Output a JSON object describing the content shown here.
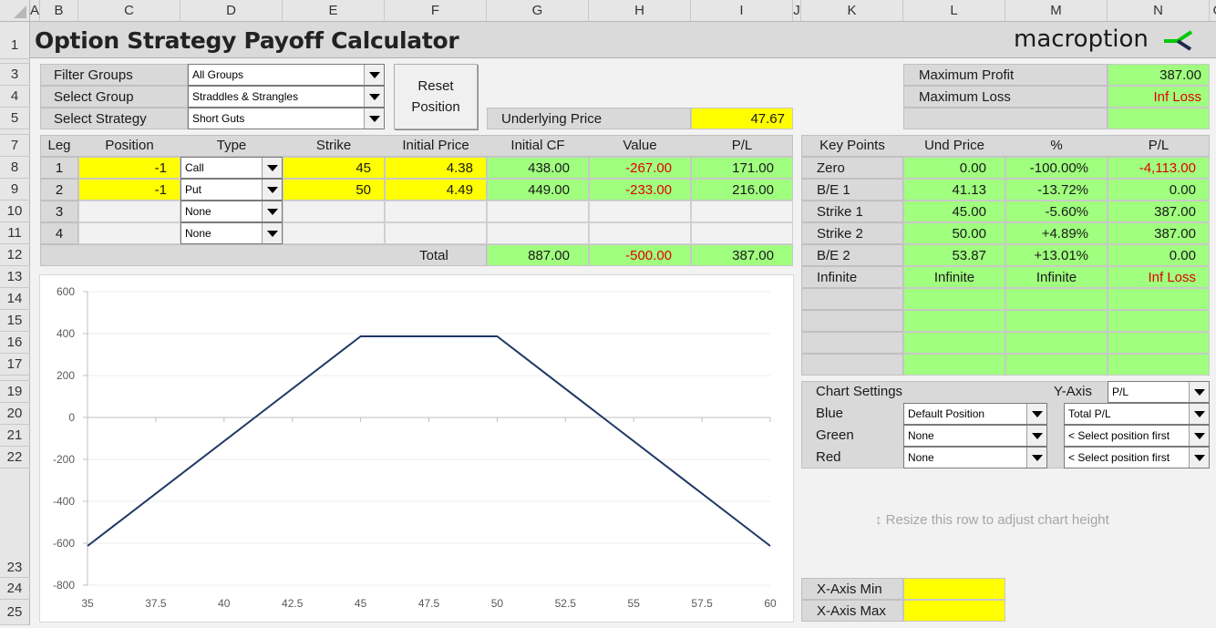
{
  "spreadsheet": {
    "columns": [
      "A",
      "B",
      "C",
      "D",
      "E",
      "F",
      "G",
      "H",
      "I",
      "J",
      "K",
      "L",
      "M",
      "N",
      "O"
    ],
    "rows": [
      "1",
      "3",
      "4",
      "5",
      "7",
      "8",
      "9",
      "10",
      "11",
      "12",
      "13",
      "14",
      "15",
      "16",
      "17",
      "19",
      "20",
      "21",
      "22",
      "23",
      "24",
      "25"
    ]
  },
  "header": {
    "title": "Option Strategy Payoff Calculator",
    "logo_text": "macroption",
    "logo_colors": {
      "green": "#00c800",
      "navy": "#1f2a4a"
    }
  },
  "selectors": {
    "filter_groups_label": "Filter Groups",
    "filter_groups_value": "All Groups",
    "select_group_label": "Select Group",
    "select_group_value": "Straddles & Strangles",
    "select_strategy_label": "Select Strategy",
    "select_strategy_value": "Short Guts"
  },
  "reset_button": {
    "line1": "Reset",
    "line2": "Position"
  },
  "underlying": {
    "label": "Underlying Price",
    "value": "47.67"
  },
  "summary": {
    "max_profit_label": "Maximum Profit",
    "max_profit_value": "387.00",
    "max_loss_label": "Maximum Loss",
    "max_loss_value": "Inf Loss"
  },
  "legs_table": {
    "headers": [
      "Leg",
      "Position",
      "Type",
      "Strike",
      "Initial Price",
      "Initial CF",
      "Value",
      "P/L"
    ],
    "rows": [
      {
        "leg": "1",
        "position": "-1",
        "type": "Call",
        "strike": "45",
        "initial_price": "4.38",
        "initial_cf": "438.00",
        "value": "-267.00",
        "pl": "171.00"
      },
      {
        "leg": "2",
        "position": "-1",
        "type": "Put",
        "strike": "50",
        "initial_price": "4.49",
        "initial_cf": "449.00",
        "value": "-233.00",
        "pl": "216.00"
      },
      {
        "leg": "3",
        "position": "",
        "type": "None",
        "strike": "",
        "initial_price": "",
        "initial_cf": "",
        "value": "",
        "pl": ""
      },
      {
        "leg": "4",
        "position": "",
        "type": "None",
        "strike": "",
        "initial_price": "",
        "initial_cf": "",
        "value": "",
        "pl": ""
      }
    ],
    "total": {
      "label": "Total",
      "initial_cf": "887.00",
      "value": "-500.00",
      "pl": "387.00"
    }
  },
  "key_points": {
    "headers": [
      "Key Points",
      "Und Price",
      "%",
      "P/L"
    ],
    "rows": [
      {
        "name": "Zero",
        "und_price": "0.00",
        "pct": "-100.00%",
        "pl": "-4,113.00",
        "pl_negative": true
      },
      {
        "name": "B/E 1",
        "und_price": "41.13",
        "pct": "-13.72%",
        "pl": "0.00",
        "pl_negative": false
      },
      {
        "name": "Strike 1",
        "und_price": "45.00",
        "pct": "-5.60%",
        "pl": "387.00",
        "pl_negative": false
      },
      {
        "name": "Strike 2",
        "und_price": "50.00",
        "pct": "+4.89%",
        "pl": "387.00",
        "pl_negative": false
      },
      {
        "name": "B/E 2",
        "und_price": "53.87",
        "pct": "+13.01%",
        "pl": "0.00",
        "pl_negative": false
      },
      {
        "name": "Infinite",
        "und_price": "Infinite",
        "pct": "Infinite",
        "pl": "Inf Loss",
        "pl_negative": true
      }
    ]
  },
  "chart_settings": {
    "title": "Chart Settings",
    "y_axis_label": "Y-Axis",
    "y_axis_value": "P/L",
    "rows": [
      {
        "label": "Blue",
        "position": "Default Position",
        "series": "Total P/L"
      },
      {
        "label": "Green",
        "position": "None",
        "series": "< Select position first"
      },
      {
        "label": "Red",
        "position": "None",
        "series": "< Select position first"
      }
    ]
  },
  "resize_hint": "Resize this row to adjust chart height",
  "x_axis": {
    "min_label": "X-Axis Min",
    "min_value": "",
    "max_label": "X-Axis Max",
    "max_value": ""
  },
  "chart_data": {
    "type": "line",
    "title": "",
    "xlabel": "",
    "ylabel": "",
    "xlim": [
      35,
      60
    ],
    "ylim": [
      -800,
      600
    ],
    "x_ticks": [
      "35",
      "37.5",
      "40",
      "42.5",
      "45",
      "47.5",
      "50",
      "52.5",
      "55",
      "57.5",
      "60"
    ],
    "y_ticks": [
      "600",
      "400",
      "200",
      "0",
      "-200",
      "-400",
      "-600",
      "-800"
    ],
    "grid": true,
    "legend": "none",
    "series": [
      {
        "name": "Total P/L",
        "color": "#1f3864",
        "x": [
          35,
          41.13,
          45,
          50,
          53.87,
          60
        ],
        "y": [
          -613,
          0,
          387,
          387,
          0,
          -613
        ]
      }
    ]
  }
}
